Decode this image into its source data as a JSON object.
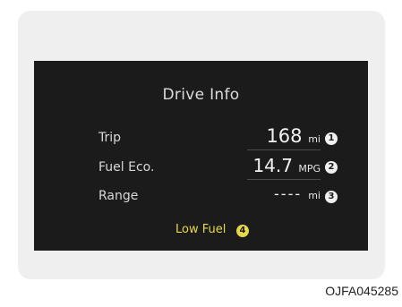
{
  "display": {
    "title": "Drive Info",
    "rows": [
      {
        "label": "Trip",
        "value": "168",
        "unit": "mi",
        "marker": "1"
      },
      {
        "label": "Fuel Eco.",
        "value": "14.7",
        "unit": "MPG",
        "marker": "2"
      },
      {
        "label": "Range",
        "value": "----",
        "unit": "mi",
        "marker": "3"
      }
    ],
    "warning": {
      "text": "Low Fuel",
      "marker": "4",
      "color": "#e6d84a"
    }
  },
  "caption": "OJFA045285"
}
